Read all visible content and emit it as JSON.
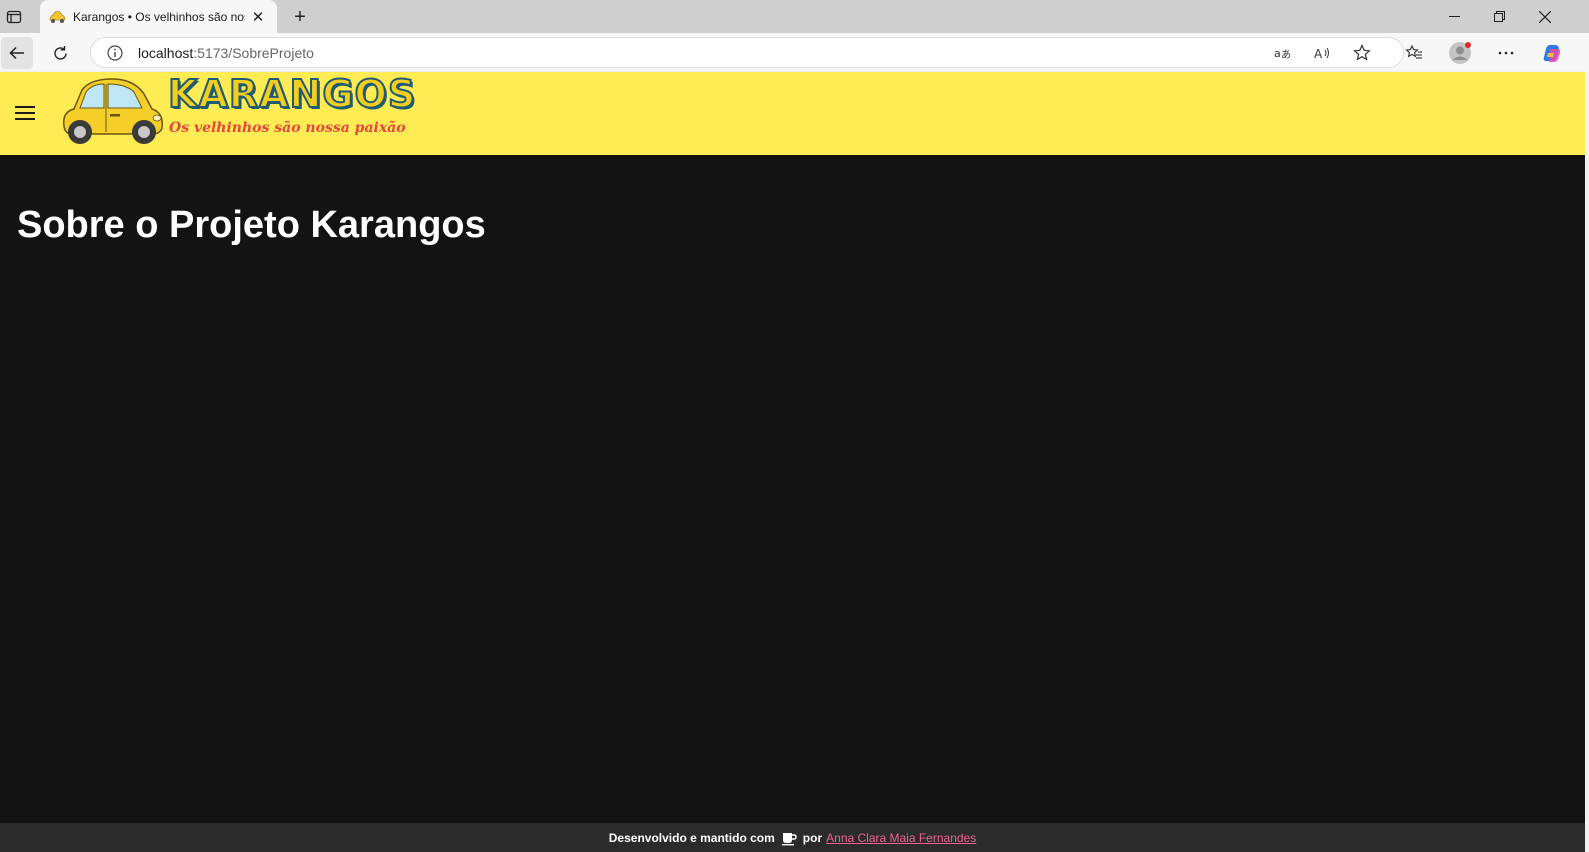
{
  "browser": {
    "tab": {
      "title": "Karangos • Os velhinhos são nossa paixão",
      "favicon": "yellow-car-icon"
    },
    "url": {
      "host": "localhost",
      "path": ":5173/SobreProjeto"
    },
    "icons": {
      "sidebar": "tab-actions-icon",
      "close_tab": "close-icon",
      "new_tab": "plus-icon",
      "back": "back-arrow-icon",
      "refresh": "refresh-icon",
      "info": "info-icon",
      "translate": "translate-icon",
      "read_aloud": "read-aloud-icon",
      "favorite": "star-icon",
      "favorites": "favorites-icon",
      "profile": "profile-icon",
      "more": "more-icon",
      "copilot": "copilot-icon"
    }
  },
  "app": {
    "logo": {
      "title": "KARANGOS",
      "slogan": "Os velhinhos são nossa paixão"
    },
    "menu_icon": "hamburger-menu-icon",
    "colors": {
      "header_bg": "#ffeb53",
      "page_bg": "#131313",
      "footer_bg": "#2b2b2b",
      "link": "#f06292"
    }
  },
  "main": {
    "title": "Sobre o Projeto Karangos"
  },
  "footer": {
    "text_before": "Desenvolvido e mantido com",
    "icon": "coffee-icon",
    "text_por": "por",
    "author_link": "Anna Clara Maia Fernandes"
  }
}
